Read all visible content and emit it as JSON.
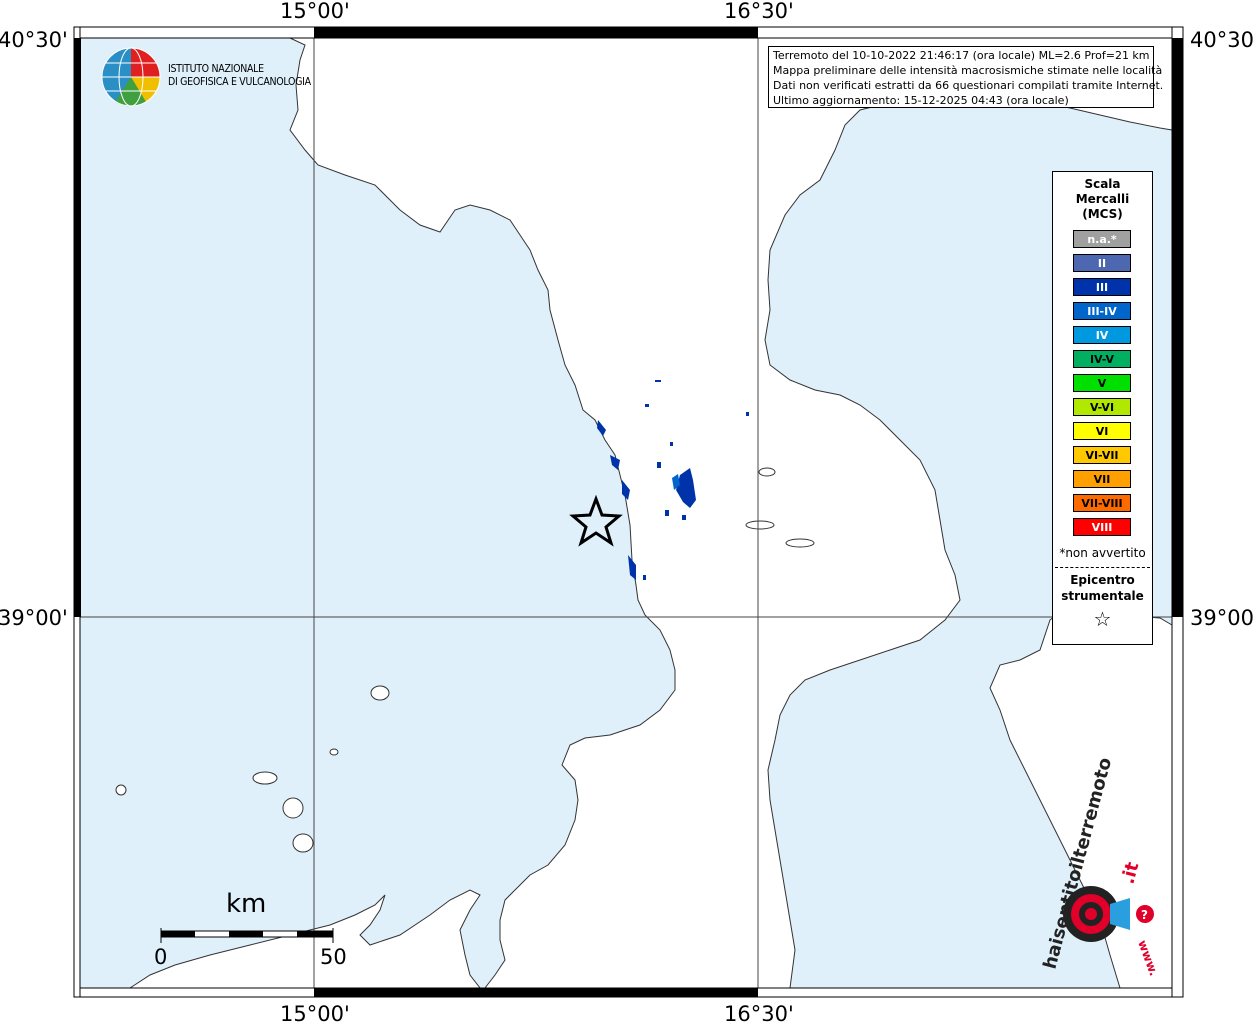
{
  "coords": {
    "top_lon_left": "15°00'",
    "top_lon_right": "16°30'",
    "bottom_lon_left": "15°00'",
    "bottom_lon_right": "16°30'",
    "lat_top_left": "40°30'",
    "lat_top_right": "40°30'",
    "lat_mid_left": "39°00'",
    "lat_mid_right": "39°00'"
  },
  "info": {
    "line1": "Terremoto del 10-10-2022 21:46:17 (ora locale) ML=2.6 Prof=21 km",
    "line2": "Mappa preliminare delle intensità macrosismiche stimate nelle località",
    "line3": "Dati non verificati estratti da 66 questionari compilati tramite Internet.",
    "line4": "Ultimo aggiornamento: 15-12-2025 04:43 (ora locale)"
  },
  "logo": {
    "line1": "ISTITUTO NAZIONALE",
    "line2": "DI GEOFISICA E VULCANOLOGIA"
  },
  "legend": {
    "title1": "Scala",
    "title2": "Mercalli",
    "title3": "(MCS)",
    "items": [
      {
        "label": "n.a.*",
        "color": "#a0a0a0"
      },
      {
        "label": "II",
        "color": "#4d68b0"
      },
      {
        "label": "III",
        "color": "#0033aa"
      },
      {
        "label": "III-IV",
        "color": "#0066cc"
      },
      {
        "label": "IV",
        "color": "#0099e0"
      },
      {
        "label": "IV-V",
        "color": "#00b060"
      },
      {
        "label": "V",
        "color": "#00e000"
      },
      {
        "label": "V-VI",
        "color": "#b0e800"
      },
      {
        "label": "VI",
        "color": "#ffff00"
      },
      {
        "label": "VI-VII",
        "color": "#ffc800"
      },
      {
        "label": "VII",
        "color": "#ffa000"
      },
      {
        "label": "VII-VIII",
        "color": "#ff6a00"
      },
      {
        "label": "VIII",
        "color": "#ff0000"
      }
    ],
    "note": "*non avvertito",
    "epi1": "Epicentro",
    "epi2": "strumentale",
    "star": "☆"
  },
  "scale": {
    "unit": "km",
    "min": "0",
    "max": "50"
  },
  "hsit": {
    "text_main": "haisentitoilterremoto",
    "text_it": ".it",
    "text_www": "www.",
    "q": "?"
  },
  "colors": {
    "sea": "#dff0fb",
    "land": "#ffffff",
    "felt_dark": "#0033aa",
    "felt_light": "#0066cc"
  }
}
